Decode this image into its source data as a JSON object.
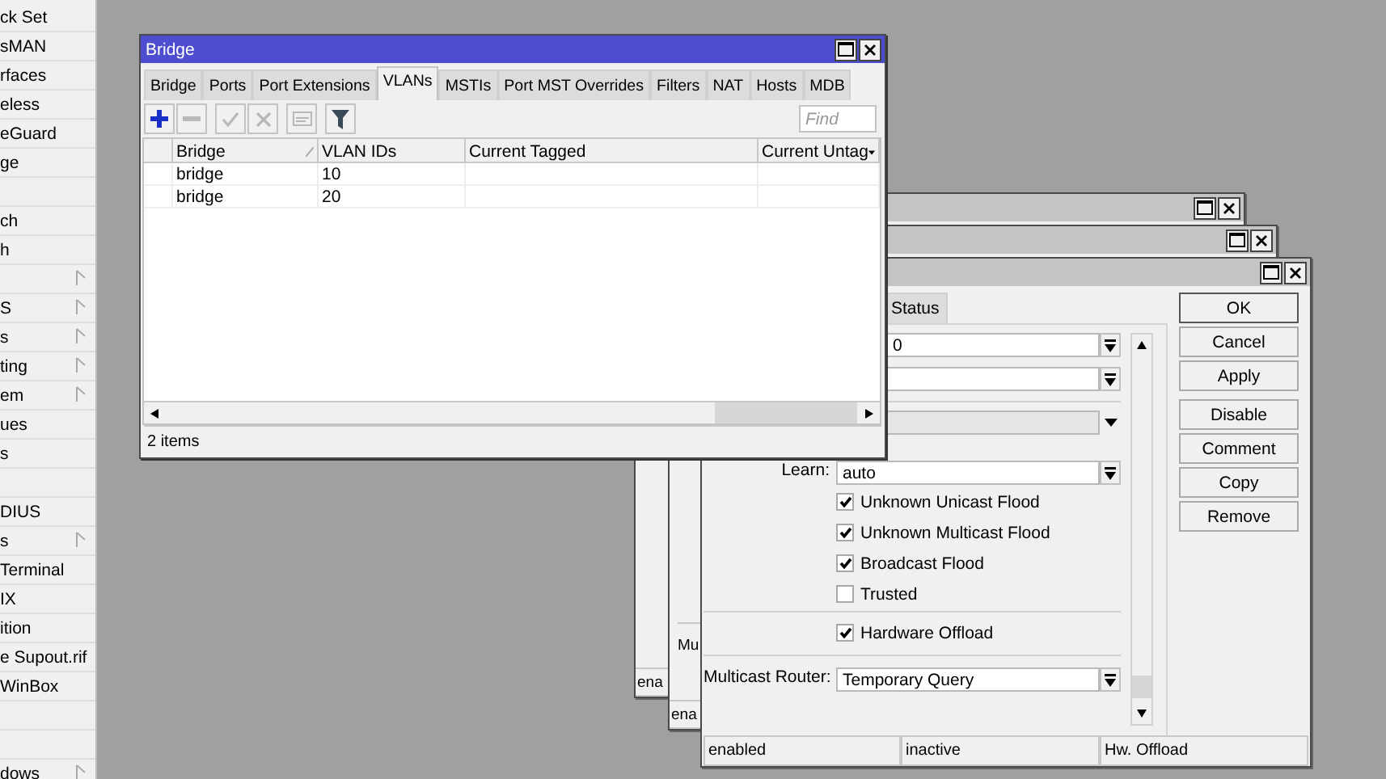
{
  "sidebar": {
    "items": [
      {
        "label": "ck Set",
        "submenu": false
      },
      {
        "label": "sMAN",
        "submenu": false
      },
      {
        "label": "rfaces",
        "submenu": false
      },
      {
        "label": "eless",
        "submenu": false
      },
      {
        "label": "eGuard",
        "submenu": false
      },
      {
        "label": "ge",
        "submenu": false
      },
      {
        "submenu": false
      },
      {
        "label": "ch",
        "submenu": false
      },
      {
        "label": "h",
        "submenu": false
      },
      {
        "submenu": true
      },
      {
        "label": "S",
        "submenu": true
      },
      {
        "label": "s",
        "submenu": true
      },
      {
        "label": "ting",
        "submenu": true
      },
      {
        "label": "em",
        "submenu": true
      },
      {
        "label": "ues",
        "submenu": false
      },
      {
        "label": "s",
        "submenu": false
      },
      {
        "submenu": false
      },
      {
        "label": "DIUS",
        "submenu": false
      },
      {
        "label": "s",
        "submenu": true
      },
      {
        "label": "Terminal",
        "submenu": false
      },
      {
        "label": "IX",
        "submenu": false
      },
      {
        "label": "ition",
        "submenu": false
      },
      {
        "label": "e Supout.rif",
        "submenu": false
      },
      {
        "label": "WinBox",
        "submenu": false
      },
      {
        "submenu": false
      },
      {
        "submenu": false
      },
      {
        "label": "dows",
        "submenu": true
      }
    ]
  },
  "back_windows": [
    {
      "status": "ena"
    },
    {
      "label": "Mu",
      "status": "ena"
    }
  ],
  "port_window": {
    "tabs": [
      {
        "label": "Status",
        "selected": false
      }
    ],
    "groups": [
      [
        {
          "kind": "combo",
          "value": "0"
        },
        {
          "kind": "combo"
        }
      ],
      [
        {
          "kind": "dropdown",
          "disabled": true
        },
        {
          "kind": "combo",
          "label": "Learn:",
          "value": "auto"
        },
        {
          "kind": "checkbox",
          "label": "Unknown Unicast Flood",
          "checked": true
        },
        {
          "kind": "checkbox",
          "label": "Unknown Multicast Flood",
          "checked": true
        },
        {
          "kind": "checkbox",
          "label": "Broadcast Flood",
          "checked": true
        },
        {
          "kind": "checkbox",
          "label": "Trusted",
          "checked": false
        }
      ],
      [
        {
          "kind": "checkbox",
          "label": "Hardware Offload",
          "checked": true
        }
      ],
      [
        {
          "kind": "combo",
          "label": "Multicast Router:",
          "value": "Temporary Query"
        }
      ]
    ],
    "buttons": [
      {
        "label": "OK",
        "default": true
      },
      {
        "label": "Cancel",
        "default": false
      },
      {
        "label": "Apply",
        "default": false
      },
      {
        "label": "Disable",
        "default": false
      },
      {
        "label": "Comment",
        "default": false
      },
      {
        "label": "Copy",
        "default": false
      },
      {
        "label": "Remove",
        "default": false
      }
    ],
    "status": [
      "enabled",
      "inactive",
      "Hw. Offload"
    ]
  },
  "bridge_window": {
    "title": "Bridge",
    "tabs": [
      {
        "label": "Bridge",
        "selected": false
      },
      {
        "label": "Ports",
        "selected": false
      },
      {
        "label": "Port Extensions",
        "selected": false
      },
      {
        "label": "VLANs",
        "selected": true
      },
      {
        "label": "MSTIs",
        "selected": false
      },
      {
        "label": "Port MST Overrides",
        "selected": false
      },
      {
        "label": "Filters",
        "selected": false
      },
      {
        "label": "NAT",
        "selected": false
      },
      {
        "label": "Hosts",
        "selected": false
      },
      {
        "label": "MDB",
        "selected": false
      }
    ],
    "toolbar": [
      {
        "kind": "add",
        "disabled": false
      },
      {
        "kind": "remove",
        "disabled": true
      },
      {
        "kind": "enable",
        "disabled": true
      },
      {
        "kind": "disable",
        "disabled": true
      },
      {
        "kind": "comment",
        "disabled": true
      },
      {
        "kind": "filter",
        "disabled": false
      }
    ],
    "find": {
      "placeholder": "Find"
    },
    "table": {
      "columns": [
        {
          "label": "Bridge",
          "sorted": true
        },
        {
          "label": "VLAN IDs",
          "sorted": false
        },
        {
          "label": "Current Tagged",
          "sorted": false
        },
        {
          "label": "Current Untag",
          "sorted": false
        }
      ],
      "rows": [
        [
          "bridge",
          "10"
        ],
        [
          "bridge",
          "20"
        ]
      ]
    },
    "status": "2 items"
  }
}
